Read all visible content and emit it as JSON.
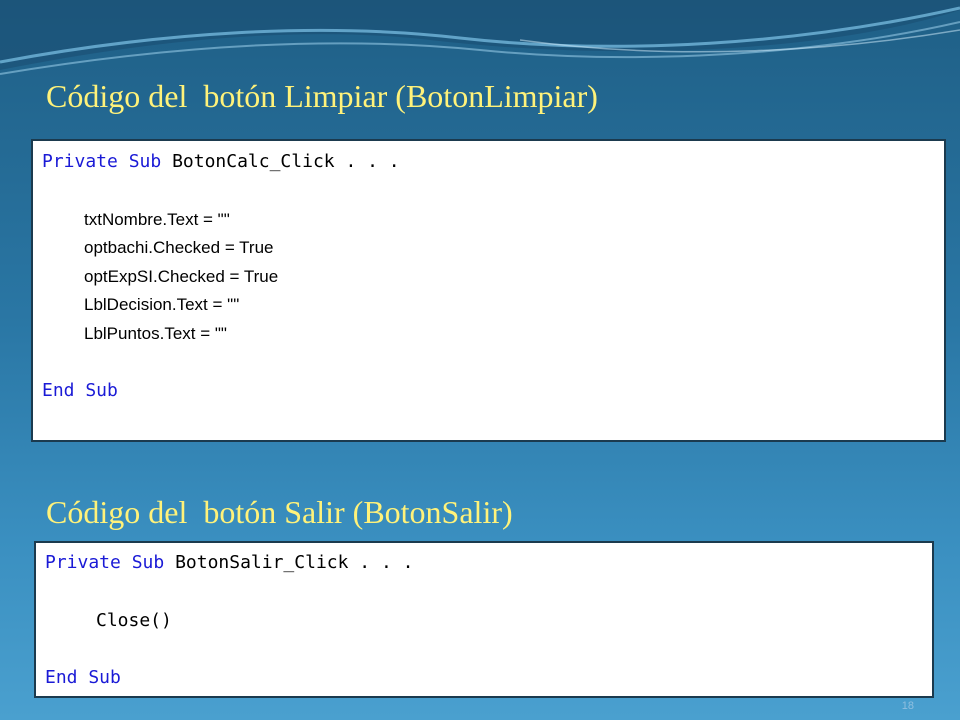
{
  "slide": {
    "heading1": "Código del  botón Limpiar (BotonLimpiar)",
    "heading2": "Código del  botón Salir (BotonSalir)",
    "page_number": "18"
  },
  "code1": {
    "kw_private": "Private",
    "kw_sub": "Sub",
    "method": "BotonCalc_Click . . .",
    "lines": [
      "txtNombre.Text = \"\"",
      "optbachi.Checked = True",
      "optExpSI.Checked = True",
      "LblDecision.Text = \"\"",
      "LblPuntos.Text = \"\""
    ],
    "end": "End Sub"
  },
  "code2": {
    "kw_private": "Private",
    "kw_sub": "Sub",
    "method": "BotonSalir_Click . . .",
    "body": "Close()",
    "end": "End Sub"
  },
  "colors": {
    "heading": "#fff27a",
    "keyword": "#1a1ad6",
    "background_top": "#1f5f86",
    "background_bottom": "#4aa0cf"
  }
}
